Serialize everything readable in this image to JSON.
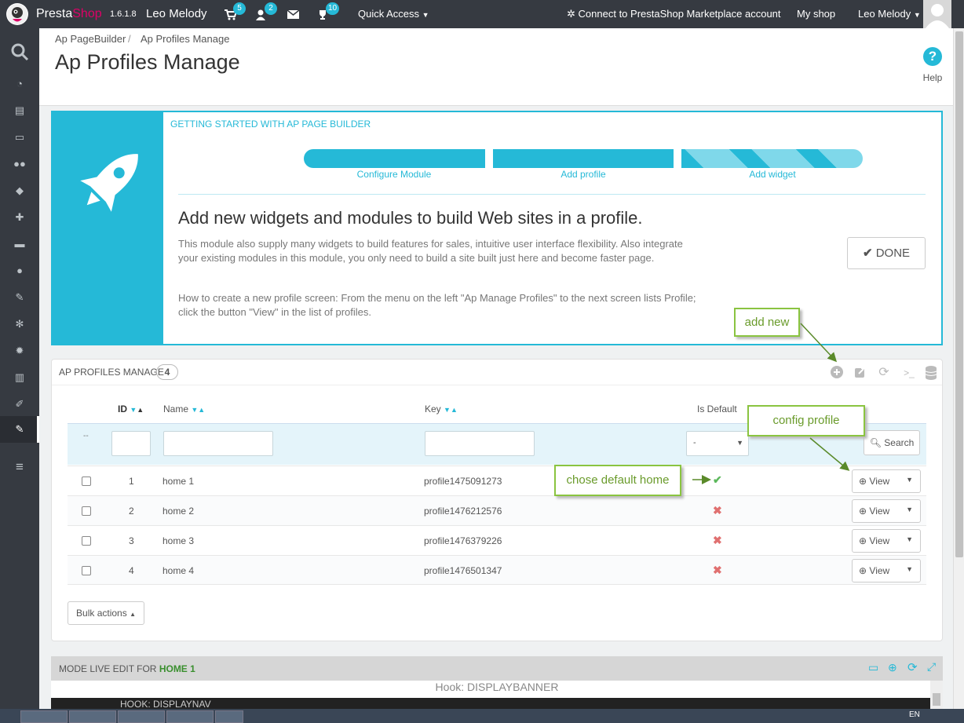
{
  "topbar": {
    "brand_presta": "Presta",
    "brand_shop": "Shop",
    "version": "1.6.1.8",
    "shop_name": "Leo Melody",
    "orders_count": "5",
    "customers_count": "2",
    "trophy_count": "10",
    "quick_access": "Quick Access",
    "marketplace": "Connect to PrestaShop Marketplace account",
    "my_shop": "My shop",
    "user": "Leo Melody"
  },
  "breadcrumb": {
    "item1": "Ap PageBuilder",
    "sep": "/",
    "item2": "Ap Profiles Manage"
  },
  "page_title": "Ap Profiles Manage",
  "help_label": "Help",
  "getting_started": {
    "title": "Getting started with Ap Page Builder",
    "steps": [
      "Configure Module",
      "Add profile",
      "Add widget"
    ],
    "heading": "Add new widgets and modules to build Web sites in a profile.",
    "paragraph1": "This module also supply many widgets to build features for sales, intuitive user interface flexibility. Also integrate your existing modules in this module, you only need to build a site built just here and become faster page.",
    "paragraph2": "How to create a new profile screen: From the menu on the left \"Ap Manage Profiles\" to the next screen lists Profile; click the button \"View\" in the list of profiles.",
    "done_label": "DONE"
  },
  "profiles_panel": {
    "title": "Ap Profiles Manage",
    "count": "4",
    "columns": {
      "id": "ID",
      "name": "Name",
      "key": "Key",
      "is_default": "Is Default"
    },
    "filter_dash": "--",
    "filter_select": "-",
    "search_label": "Search",
    "view_label": "View",
    "bulk_actions": "Bulk actions",
    "rows": [
      {
        "id": "1",
        "name": "home 1",
        "key": "profile1475091273",
        "default": true
      },
      {
        "id": "2",
        "name": "home 2",
        "key": "profile1476212576",
        "default": false
      },
      {
        "id": "3",
        "name": "home 3",
        "key": "profile1476379226",
        "default": false
      },
      {
        "id": "4",
        "name": "home 4",
        "key": "profile1476501347",
        "default": false
      }
    ]
  },
  "callouts": {
    "add_new": "add new",
    "config_profile": "config profile",
    "chose_default": "chose default home"
  },
  "live_edit": {
    "label": "MODE LIVE EDIT FOR",
    "profile": "HOME 1",
    "hook_banner": "Hook: DISPLAYBANNER",
    "hook_nav": "HOOK: DISPLAYNAV"
  },
  "taskbar": {
    "lang": "EN"
  },
  "colors": {
    "accent": "#25b9d7",
    "topbar": "#363a41",
    "callout_green": "#8ac440",
    "check_green": "#5cb85c",
    "cross_red": "#e07070"
  }
}
